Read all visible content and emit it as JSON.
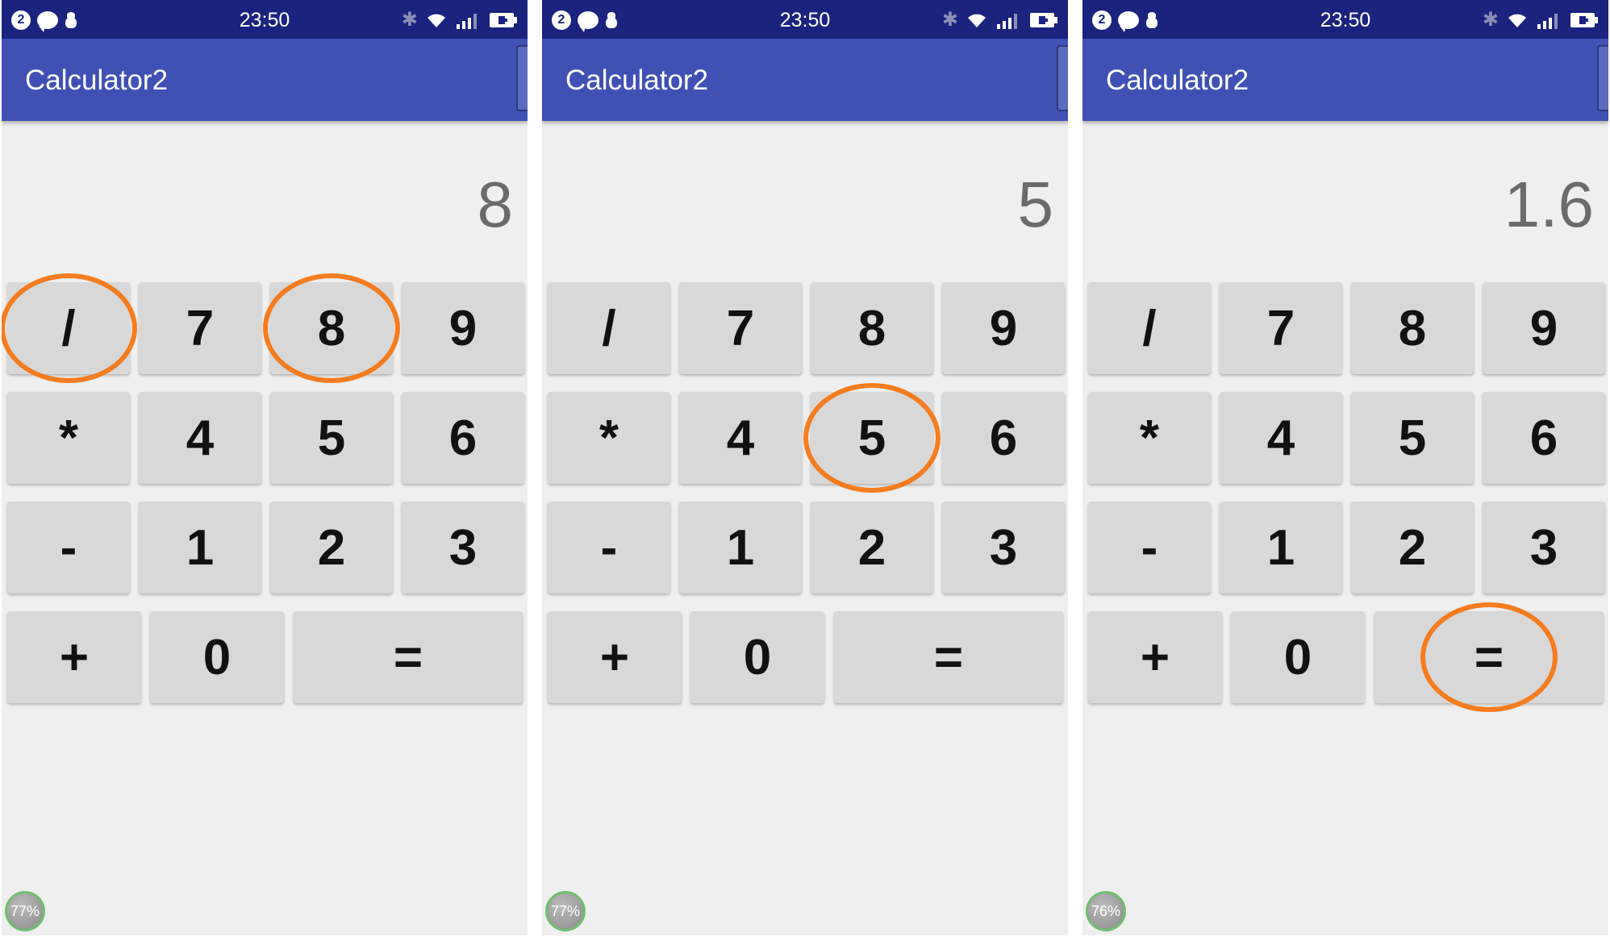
{
  "screens": [
    {
      "status": {
        "notif_count": "2",
        "time": "23:50"
      },
      "app_title": "Calculator2",
      "display": "8",
      "memory_label": "77%",
      "buttons": [
        "/",
        "7",
        "8",
        "9",
        "*",
        "4",
        "5",
        "6",
        "-",
        "1",
        "2",
        "3",
        "+",
        "0",
        "="
      ],
      "highlighted": [
        "/",
        "8"
      ]
    },
    {
      "status": {
        "notif_count": "2",
        "time": "23:50"
      },
      "app_title": "Calculator2",
      "display": "5",
      "memory_label": "77%",
      "buttons": [
        "/",
        "7",
        "8",
        "9",
        "*",
        "4",
        "5",
        "6",
        "-",
        "1",
        "2",
        "3",
        "+",
        "0",
        "="
      ],
      "highlighted": [
        "5"
      ]
    },
    {
      "status": {
        "notif_count": "2",
        "time": "23:50"
      },
      "app_title": "Calculator2",
      "display": "1.6",
      "memory_label": "76%",
      "buttons": [
        "/",
        "7",
        "8",
        "9",
        "*",
        "4",
        "5",
        "6",
        "-",
        "1",
        "2",
        "3",
        "+",
        "0",
        "="
      ],
      "highlighted": [
        "="
      ]
    }
  ],
  "colors": {
    "status_bar": "#1a237e",
    "app_bar": "#3f51b5",
    "background": "#efefef",
    "button": "#d8d8d8",
    "highlight_circle": "#f57c1f"
  },
  "icons": [
    "chat-icon",
    "android-debug-icon",
    "bluetooth-icon",
    "wifi-icon",
    "signal-icon",
    "battery-icon"
  ]
}
